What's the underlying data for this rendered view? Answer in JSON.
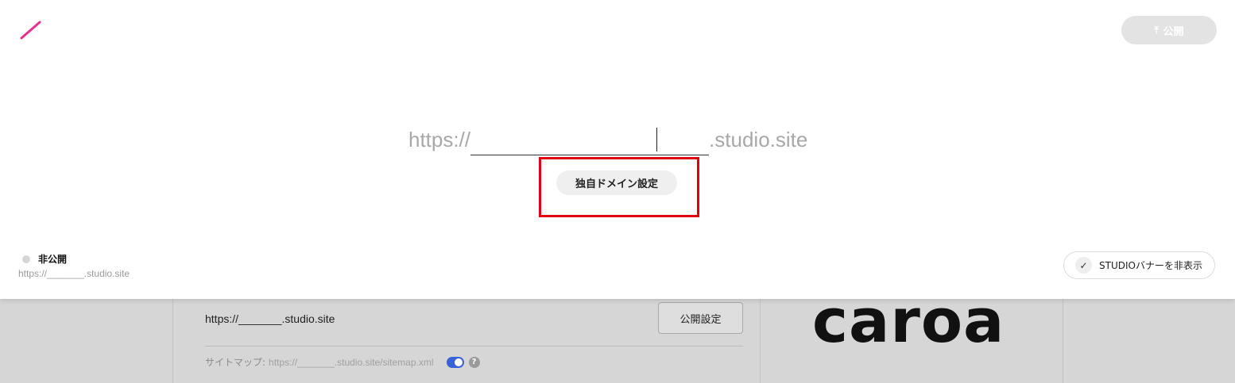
{
  "header": {
    "logo_icon": "slash-logo-icon",
    "logo_color": "#e8318f",
    "publish_label": "公開",
    "publish_icon": "upload-arrow-icon"
  },
  "domain": {
    "prefix": "https://",
    "subdomain_value": "",
    "suffix": ".studio.site",
    "custom_domain_button": "独自ドメイン設定"
  },
  "status": {
    "label": "非公開",
    "url": "https://_______.studio.site"
  },
  "banner": {
    "label": "STUDIOバナーを非表示",
    "check_icon": "check-icon"
  },
  "background": {
    "site_url": "https://_______.studio.site",
    "publish_settings_button": "公開設定",
    "sitemap_label": "サイトマップ:",
    "sitemap_url": "https://_______.studio.site/sitemap.xml",
    "help_glyph": "?",
    "preview_logo_text": "caroa"
  },
  "highlight_color": "#e0000f"
}
